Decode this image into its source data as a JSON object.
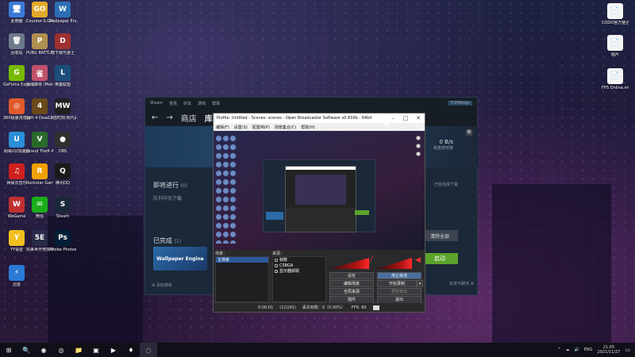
{
  "desktop_icons": [
    {
      "label": "此电脑",
      "glyph": "🖥",
      "color": "#3b7bd6"
    },
    {
      "label": "Counter-S Global Off...",
      "glyph": "GO",
      "color": "#e2a92a"
    },
    {
      "label": "Wallpaper Engine: ...",
      "glyph": "W",
      "color": "#2d6fb5"
    },
    {
      "label": "回收站",
      "glyph": "🗑",
      "color": "#6d7a8a"
    },
    {
      "label": "PUBG BATTLEGR...",
      "glyph": "P",
      "color": "#b09050"
    },
    {
      "label": "地下城与勇士",
      "glyph": "D",
      "color": "#a03030"
    },
    {
      "label": "GeForce Experience",
      "glyph": "G",
      "color": "#76b900"
    },
    {
      "label": "雀魂麻将 (Mahjong...",
      "glyph": "雀",
      "color": "#c0506a"
    },
    {
      "label": "英雄联盟",
      "glyph": "L",
      "color": "#1b4f7a"
    },
    {
      "label": "360极速浏览器X",
      "glyph": "◎",
      "color": "#e05a2a"
    },
    {
      "label": "Left 4 Dead 2",
      "glyph": "4",
      "color": "#6a4a1a"
    },
    {
      "label": "决胜时刻:现代战争",
      "glyph": "MW",
      "color": "#202020"
    },
    {
      "label": "网易UU加速器",
      "glyph": "U",
      "color": "#2a8fd6"
    },
    {
      "label": "Grand Theft Auto V",
      "glyph": "V",
      "color": "#2a6a2a"
    },
    {
      "label": "OBS",
      "glyph": "●",
      "color": "#303030"
    },
    {
      "label": "网易云音乐",
      "glyph": "♫",
      "color": "#d02020"
    },
    {
      "label": "Rockstar Games...",
      "glyph": "R",
      "color": "#f0a000"
    },
    {
      "label": "腾讯QQ",
      "glyph": "Q",
      "color": "#1a1a1a"
    },
    {
      "label": "WeGame",
      "glyph": "W",
      "color": "#c03030"
    },
    {
      "label": "微信",
      "glyph": "✉",
      "color": "#1aad19"
    },
    {
      "label": "Steam",
      "glyph": "S",
      "color": "#1b2838"
    },
    {
      "label": "YY语音",
      "glyph": "Y",
      "color": "#f0c020"
    },
    {
      "label": "完美世界竞技平台",
      "glyph": "5E",
      "color": "#2a2a4a"
    },
    {
      "label": "Adobe Photosh...",
      "glyph": "Ps",
      "color": "#001e36"
    },
    {
      "label": "迅雷",
      "glyph": "⚡",
      "color": "#2a7ad6"
    }
  ],
  "right_icons": [
    {
      "label": "CODO官方整合包",
      "glyph": "📄"
    },
    {
      "label": "图片",
      "glyph": "📄"
    },
    {
      "label": "FPS Online.mtx",
      "glyph": "📄"
    }
  ],
  "steam": {
    "top_items": [
      "Steam",
      "查看",
      "好友",
      "游戏",
      "帮助"
    ],
    "account": "TOMBlogs",
    "nav": [
      "←",
      "→",
      "商店",
      "库",
      "社"
    ],
    "upcoming": "即将进行",
    "upcoming_count": "(0)",
    "upcoming_sub": "队列中无下载",
    "completed": "已完成",
    "completed_count": "(1)",
    "thumb_label": "Wallpaper Engine",
    "add_game": "添加游戏",
    "rate": "0 B/s",
    "rate_sub": "磁盘使用量",
    "side_text": "已经完成下载",
    "remove_all": "清除全部",
    "launch": "启动",
    "friends": "好友与聊天"
  },
  "obs": {
    "title": "Profile: Untitled - Scenes: scenes - Open Broadcaster Software v0.659b - 64bit",
    "menu": [
      "编辑(F)",
      "设置(S)",
      "配置档(P)",
      "场景集合(C)",
      "帮助(H)"
    ],
    "scenes_label": "场景：",
    "scene_item": "主场景",
    "sources_label": "来源：",
    "sources": [
      {
        "name": "帧数",
        "checked": false
      },
      {
        "name": "CSBGA",
        "checked": false
      },
      {
        "name": "显示器获取",
        "checked": true
      }
    ],
    "buttons": {
      "settings": "设定",
      "stop_stream": "停止串流",
      "edit_scene": "编辑场景",
      "start_record": "开始录制",
      "global_sources": "全局来源",
      "preview": "预览串流",
      "plugins": "插件",
      "exit": "退出"
    },
    "status": {
      "time": "0:00:01",
      "dropped": "(12)(91)",
      "frames": "丢失帧数：0（0.00%）",
      "fps": "FPS: 60"
    }
  },
  "taskbar": {
    "apps": [
      "⊞",
      "🔍",
      "◉",
      "◎",
      "📁",
      "▣",
      "▶",
      "♦",
      "◌"
    ],
    "tray": [
      "^",
      "☁",
      "🔊",
      "ENG"
    ],
    "time": "21:05",
    "date": "2021/11/27"
  }
}
